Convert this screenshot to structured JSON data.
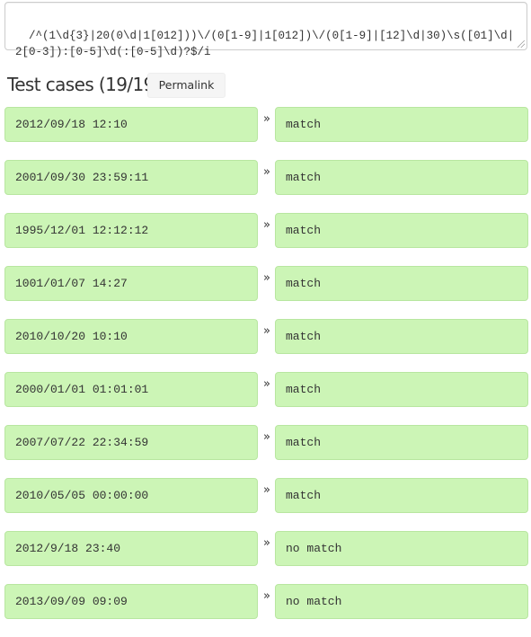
{
  "regex": {
    "value": "/^(1\\d{3}|20(0\\d|1[012]))\\/(0[1-9]|1[012])\\/(0[1-9]|[12]\\d|30)\\s([01]\\d|2[0-3]):[0-5]\\d(:[0-5]\\d)?$/i"
  },
  "test_cases": {
    "heading": "Test cases (19/19)",
    "permalink_label": "Permalink",
    "arrow_glyph": "»",
    "rows": [
      {
        "input": "2012/09/18 12:10",
        "result": "match"
      },
      {
        "input": "2001/09/30 23:59:11",
        "result": "match"
      },
      {
        "input": "1995/12/01 12:12:12",
        "result": "match"
      },
      {
        "input": "1001/01/07 14:27",
        "result": "match"
      },
      {
        "input": "2010/10/20 10:10",
        "result": "match"
      },
      {
        "input": "2000/01/01 01:01:01",
        "result": "match"
      },
      {
        "input": "2007/07/22 22:34:59",
        "result": "match"
      },
      {
        "input": "2010/05/05 00:00:00",
        "result": "match"
      },
      {
        "input": "2012/9/18 23:40",
        "result": "no match"
      },
      {
        "input": "2013/09/09 09:09",
        "result": "no match"
      }
    ]
  },
  "colors": {
    "pass_bg": "#ccf5b6",
    "pass_border": "#b8e6a0"
  }
}
